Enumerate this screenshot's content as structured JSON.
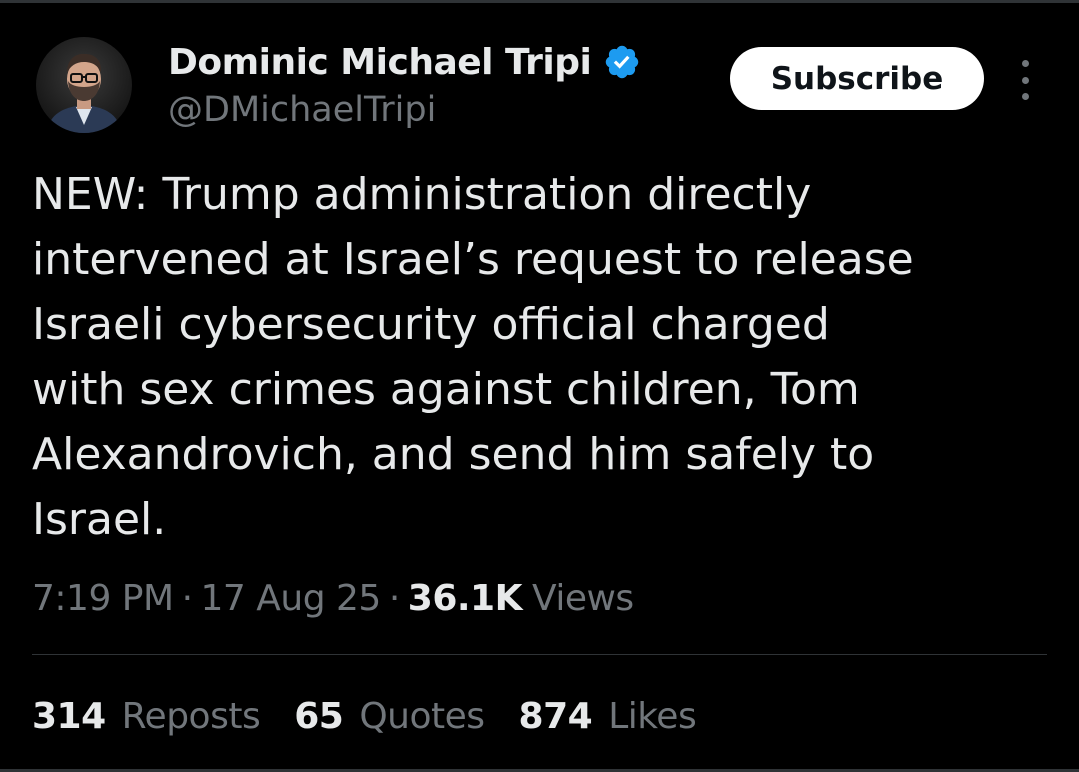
{
  "author": {
    "name": "Dominic Michael Tripi",
    "handle": "@DMichaelTripi",
    "verified": true,
    "avatar_icon": "profile-photo"
  },
  "actions": {
    "subscribe_label": "Subscribe",
    "more_icon": "more-vertical-icon"
  },
  "tweet": {
    "lines": [
      "NEW: Trump administration directly",
      "intervened at Israel’s request to release",
      "Israeli cybersecurity official charged",
      "with sex crimes against children, Tom",
      "Alexandrovich, and send him safely to",
      "Israel."
    ],
    "time": "7:19 PM",
    "date": "17 Aug 25",
    "separator": "·",
    "views_count": "36.1K",
    "views_label": "Views"
  },
  "stats": {
    "reposts_count": "314",
    "reposts_label": "Reposts",
    "quotes_count": "65",
    "quotes_label": "Quotes",
    "likes_count": "874",
    "likes_label": "Likes"
  },
  "colors": {
    "background": "#000000",
    "text_primary": "#e7e9ea",
    "text_secondary": "#71767b",
    "verified_badge": "#1d9bf0",
    "subscribe_bg": "#ffffff"
  }
}
